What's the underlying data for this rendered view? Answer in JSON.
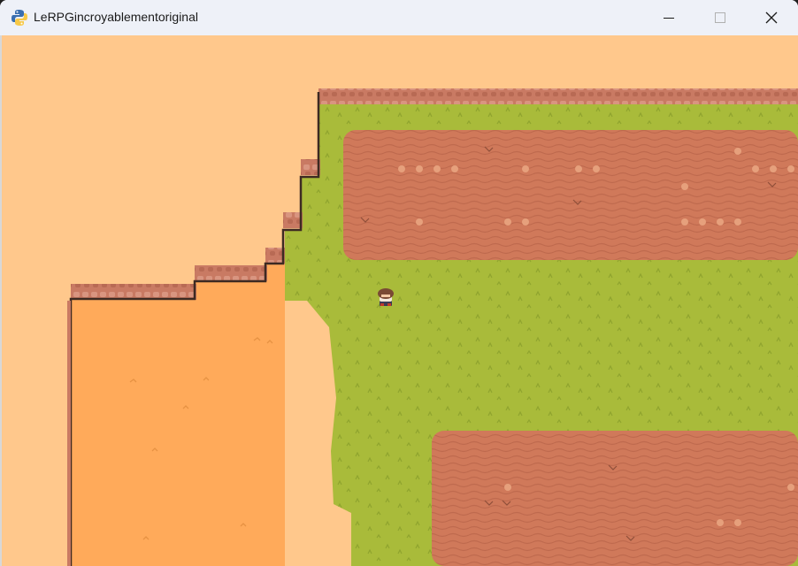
{
  "window": {
    "title": "LeRPGincroyablementoriginal",
    "controls": [
      "minimize",
      "maximize",
      "close"
    ]
  },
  "icons": {
    "app": "python-icon",
    "minimize": "minimize-icon",
    "maximize": "maximize-icon",
    "close": "close-icon"
  },
  "colors": {
    "titlebar": "#eef1f8",
    "sky_sand": "#ffc88c",
    "lower_sand": "#ffaa5a",
    "grass": "#a9bb3a",
    "grass_dark": "#8fa42e",
    "dirt_field": "#d0795a",
    "dirt_field_dark": "#bf6a4e",
    "cliff": "#c97a63",
    "cliff_dark": "#3d2a22"
  },
  "scene": {
    "player": "player-sprite",
    "terrain": [
      "upper-sand-plateau",
      "cliff-edge",
      "lower-sand-area",
      "grass-field",
      "dirt-field-top",
      "dirt-field-bottom"
    ]
  }
}
